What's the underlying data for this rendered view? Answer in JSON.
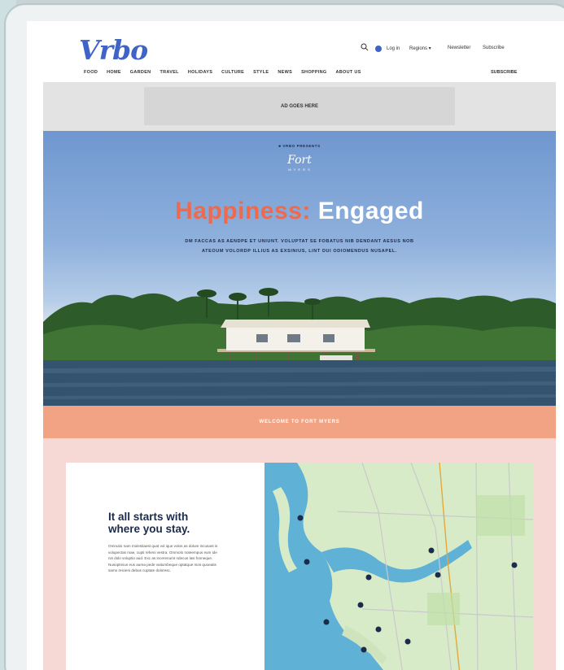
{
  "brand": {
    "logo": "Vrbo",
    "accent": "#3f63c6"
  },
  "utility": {
    "search_icon": "search-icon",
    "login_label": "Log in",
    "regions_label": "Regions ▾",
    "newsletter_label": "Newsletter",
    "subscribe_top": "Subscribe"
  },
  "nav": {
    "items": [
      "FOOD",
      "HOME",
      "GARDEN",
      "TRAVEL",
      "HOLIDAYS",
      "CULTURE",
      "STYLE",
      "NEWS",
      "SHOPPING",
      "ABOUT US"
    ],
    "subscribe": "SUBSCRIBE"
  },
  "ad": {
    "label": "AD GOES HERE"
  },
  "hero": {
    "kicker": "■ VRBO PRESENTS",
    "script": "Fort",
    "script_sub": "M Y E R S",
    "headline_1": "Happiness:",
    "headline_2": "Engaged",
    "subline": "DM FACCAS AS AENDPE ET UNIUNT. VOLUPTAT SE FOBATUS NIB DENDANT AESUS NOB ATEOUM VOLORDP ILLIUS AS EXSINIUS, LINT DUI ODIOMENDUS NUSAPEL.",
    "headline_color": "#ee6a4f"
  },
  "banner": {
    "label": "WELCOME TO FORT MYERS",
    "color": "#f2a383"
  },
  "card": {
    "title": "It all starts with where you stay.",
    "body": "Omnutio nam molestiaest quat vol ique volos as dolum incusant is volupectas mae, cupti reheni vestra. Ommolo noteempus eum ide nis dolo voluptio aud. Exc as incerenumt ndecus lasi fonneque. Nusoptmius eus aurea pede vaitumbeque optatque mos quoeatis samo reicieni debus cuptate doloresc."
  }
}
